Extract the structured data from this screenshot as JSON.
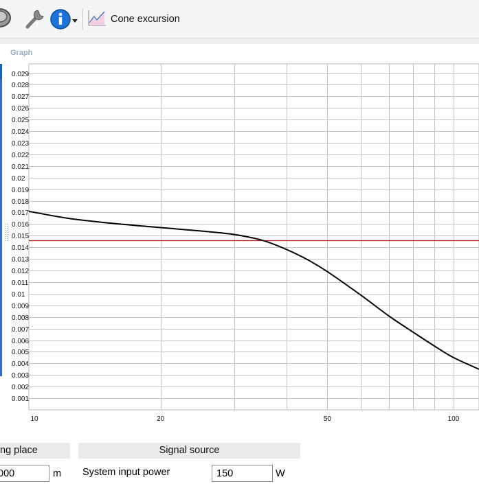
{
  "toolbar": {
    "speaker_icon": "speaker-icon",
    "wrench_icon": "wrench-icon",
    "info_icon": "info-icon",
    "cone_button_label": "Cone excursion"
  },
  "graph": {
    "caption": "Graph"
  },
  "chart_data": {
    "type": "line",
    "xscale": "log",
    "xlim": [
      9.7,
      115
    ],
    "ylim": [
      0,
      0.0298
    ],
    "x_ticks": [
      10,
      20,
      50,
      100
    ],
    "y_ticks": [
      "0.001",
      "0.002",
      "0.003",
      "0.004",
      "0.005",
      "0.006",
      "0.007",
      "0.008",
      "0.009",
      "0.01",
      "0.011",
      "0.012",
      "0.013",
      "0.014",
      "0.015",
      "0.016",
      "0.017",
      "0.018",
      "0.019",
      "0.02",
      "0.021",
      "0.022",
      "0.023",
      "0.024",
      "0.025",
      "0.026",
      "0.027",
      "0.028",
      "0.029"
    ],
    "reference_line": {
      "y": 0.0146,
      "color": "#b02020"
    },
    "series": [
      {
        "color": "#000000",
        "x": [
          9.7,
          12,
          15,
          20,
          25,
          30,
          35,
          40,
          45,
          50,
          60,
          70,
          80,
          90,
          100,
          115
        ],
        "y": [
          0.0171,
          0.0165,
          0.0161,
          0.0157,
          0.0154,
          0.0151,
          0.0146,
          0.0138,
          0.0129,
          0.0119,
          0.0099,
          0.0081,
          0.0067,
          0.0055,
          0.0045,
          0.0035
        ]
      }
    ]
  },
  "bottom": {
    "mounting_header": "ng place",
    "mounting_value": "000",
    "mounting_unit": "m",
    "signal_header": "Signal source",
    "power_label": "System input power",
    "power_value": "150",
    "power_unit": "W"
  }
}
